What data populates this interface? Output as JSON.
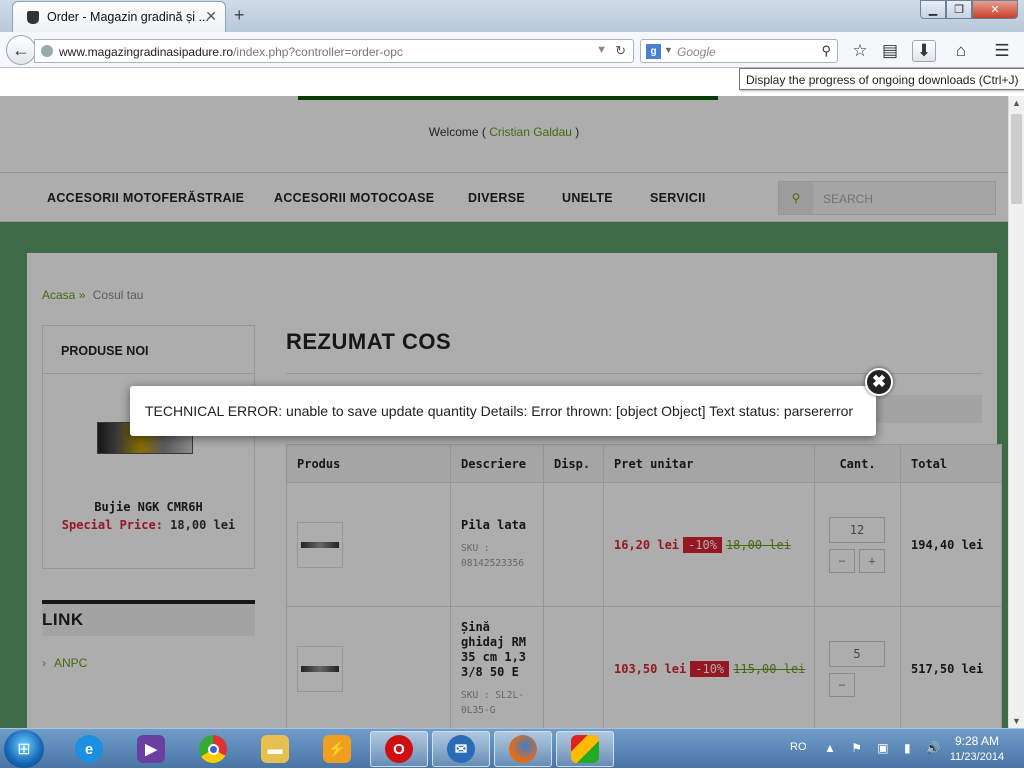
{
  "browser": {
    "tab_title": "Order - Magazin gradină și ...",
    "tab_close": "✕",
    "new_tab": "+",
    "url_host": "www.magazingradinasipadure.ro",
    "url_path": "/index.php?controller=order-opc",
    "search_placeholder": "Google",
    "search_engine_letter": "g",
    "tooltip": "Display the progress of ongoing downloads (Ctrl+J)",
    "window_buttons": {
      "minimize": "▁",
      "maximize": "❐",
      "close": "✕"
    },
    "toolbar_icons": [
      "star-icon",
      "bookmarks-list-icon",
      "download-icon",
      "home-icon",
      "menu-icon"
    ]
  },
  "site": {
    "welcome_prefix": "Welcome (",
    "welcome_user": " Cristian Galdau ",
    "welcome_suffix": ")",
    "menu": [
      "ACCESORII MOTOFERĂSTRAIE",
      "ACCESORII MOTOCOASE",
      "DIVERSE",
      "UNELTE",
      "SERVICII"
    ],
    "search_placeholder": "SEARCH",
    "breadcrumb": {
      "home": "Acasa",
      "sep": "»",
      "current": "Cosul tau"
    },
    "sidebar": {
      "new_products_title": "PRODUSE NOI",
      "product_name": "Bujie NGK CMR6H",
      "special_price_label": "Special Price:",
      "special_price_value": "18,00 lei",
      "link_title": "LINK",
      "link_item": "ANPC"
    },
    "page_title": "REZUMAT COS",
    "table": {
      "headers": [
        "Produs",
        "Descriere",
        "Disp.",
        "Pret unitar",
        "Cant.",
        "Total"
      ],
      "rows": [
        {
          "name": "Pila lata",
          "sku": "SKU : 08142523356",
          "new_price": "16,20 lei",
          "discount": "-10%",
          "old_price": "18,00 lei",
          "qty": "12",
          "total": "194,40 lei"
        },
        {
          "name": "Șină ghidaj RM 35 cm 1,3 3/8 50 E",
          "sku": "SKU : SL2L-0L35-G",
          "new_price": "103,50 lei",
          "discount": "-10%",
          "old_price": "115,00 lei",
          "qty": "5",
          "total": "517,50 lei"
        }
      ],
      "qty_minus": "−",
      "qty_plus": "+"
    }
  },
  "dialog": {
    "message": "TECHNICAL ERROR: unable to save update quantity Details: Error thrown: [object Object] Text status: parsererror",
    "close": "✖"
  },
  "taskbar": {
    "apps": [
      "internet-explorer-icon",
      "visual-studio-icon",
      "chrome-icon",
      "file-explorer-icon",
      "media-player-icon",
      "opera-icon",
      "thunderbird-icon",
      "firefox-icon",
      "avg-icon"
    ],
    "lang": "RO",
    "time": "9:28 AM",
    "date": "11/23/2014"
  },
  "colors": {
    "accent_green": "#6b9a1c",
    "price_red": "#d23",
    "page_bg_green": "#5a9e6a"
  }
}
